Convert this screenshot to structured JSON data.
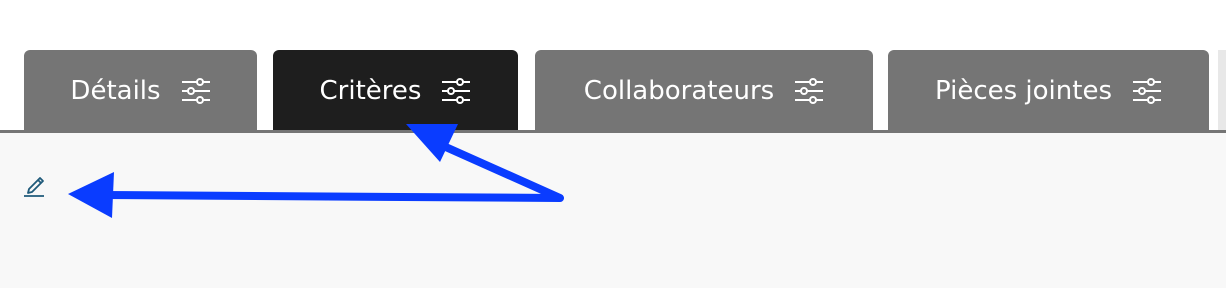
{
  "tabs": [
    {
      "label": "Détails",
      "icon": "sliders-icon",
      "active": false
    },
    {
      "label": "Critères",
      "icon": "sliders-icon",
      "active": true
    },
    {
      "label": "Collaborateurs",
      "icon": "sliders-icon",
      "active": false
    },
    {
      "label": "Pièces jointes",
      "icon": "sliders-icon",
      "active": false
    }
  ],
  "content": {
    "edit_icon": "pencil-edit-icon"
  },
  "annotation": {
    "color": "#0a3cff"
  },
  "colors": {
    "tab_inactive": "#757575",
    "tab_active": "#1e1e1e",
    "content_bg": "#f8f8f8",
    "edit_icon": "#1f5a7a"
  }
}
